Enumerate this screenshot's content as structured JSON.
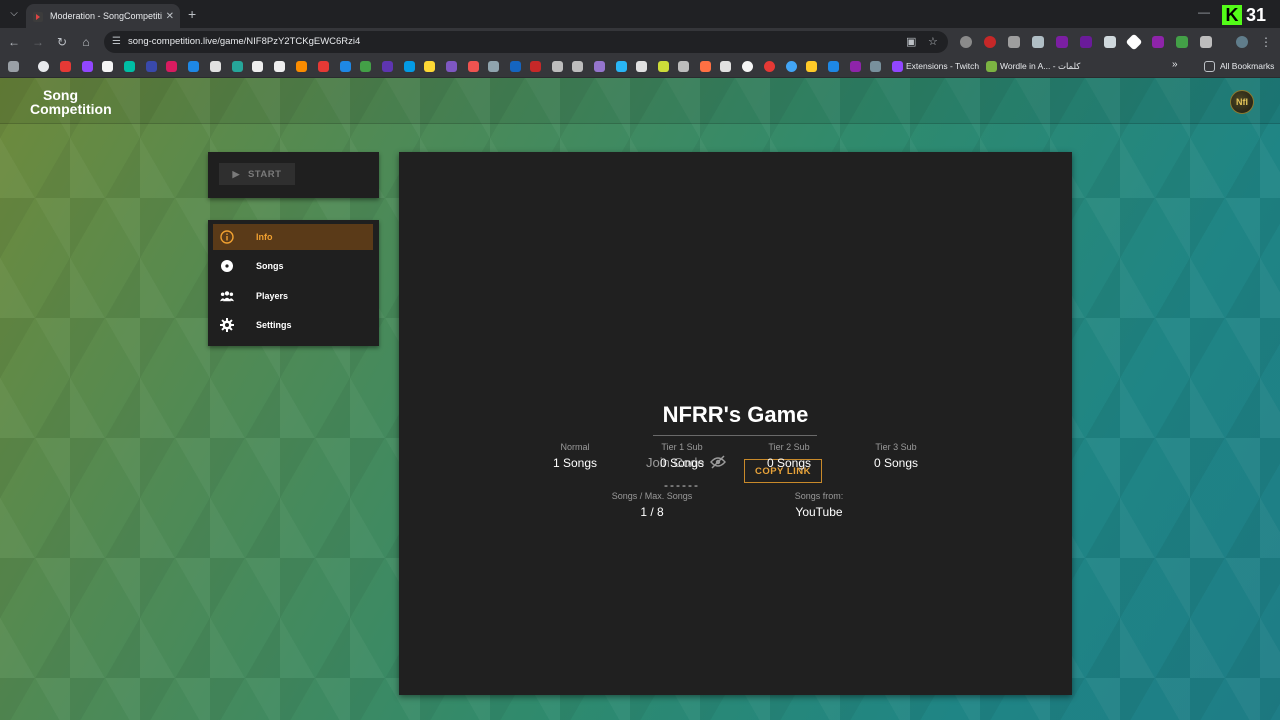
{
  "browser": {
    "tab_title": "Moderation - SongCompetition",
    "url": "song-competition.live/game/NIF8PzY2TCKgEWC6Rzi4",
    "badge_number": "31",
    "bookmarks": {
      "extensions_twitch": "Extensions - Twitch",
      "wordle": "Wordle in A... - كلمات",
      "all_bookmarks": "All Bookmarks"
    }
  },
  "site": {
    "logo_line1": "Song",
    "logo_line2": "Competition",
    "avatar_text": "NfI"
  },
  "controls": {
    "start_label": "START"
  },
  "menu": {
    "items": [
      {
        "label": "Info",
        "icon": "info-icon"
      },
      {
        "label": "Songs",
        "icon": "disc-icon"
      },
      {
        "label": "Players",
        "icon": "players-icon"
      },
      {
        "label": "Settings",
        "icon": "gear-icon"
      }
    ]
  },
  "game": {
    "title": "NFRR's Game",
    "join_label": "Join Code",
    "join_code": "------",
    "copy_label": "COPY LINK",
    "stats": [
      {
        "label": "Normal",
        "value": "1 Songs"
      },
      {
        "label": "Tier 1 Sub",
        "value": "0 Songs"
      },
      {
        "label": "Tier 2 Sub",
        "value": "0 Songs"
      },
      {
        "label": "Tier 3 Sub",
        "value": "0 Songs"
      }
    ],
    "songs_max_label": "Songs / Max. Songs",
    "songs_max_value": "1 / 8",
    "songs_from_label": "Songs from:",
    "songs_from_value": "YouTube"
  },
  "colors": {
    "accent": "#e8a33a",
    "active_bg": "#5a3a18",
    "card_bg": "#202020"
  }
}
